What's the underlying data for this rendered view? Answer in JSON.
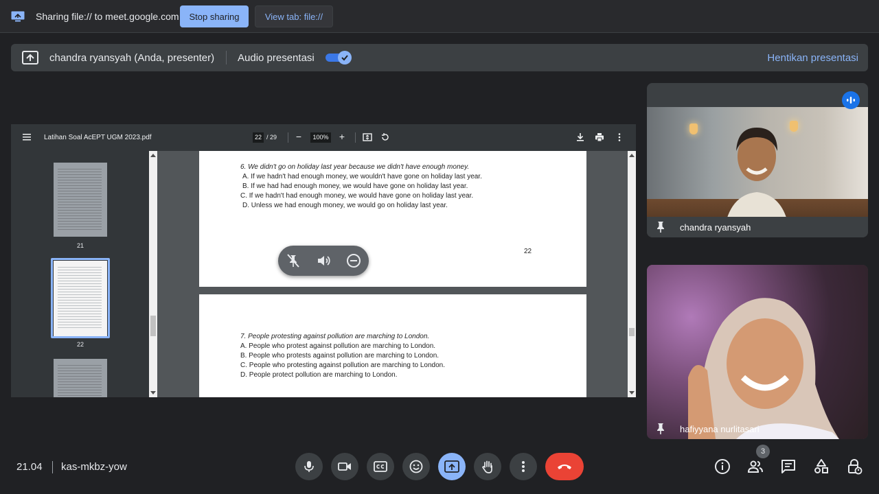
{
  "sharing_bar": {
    "text": "Sharing file:// to meet.google.com",
    "stop_label": "Stop sharing",
    "view_label": "View tab: file://"
  },
  "presenting_bar": {
    "presenter": "chandra ryansyah (Anda, presenter)",
    "audio_label": "Audio presentasi",
    "audio_on": true,
    "stop_label": "Hentikan presentasi"
  },
  "pdf": {
    "filename": "Latihan Soal AcEPT UGM 2023.pdf",
    "current_page": "22",
    "total_pages": "/ 29",
    "zoom": "100%",
    "thumbnails": [
      {
        "number": "21"
      },
      {
        "number": "22",
        "selected": true
      }
    ],
    "page_22": {
      "question": "6. We didn't go on holiday last year because we didn't have enough money.",
      "options": [
        "A. If we hadn't had enough money, we wouldn't have gone on holiday last year.",
        "B. If we had had enough money, we would have gone on holiday last year.",
        "C. If we hadn't had enough money, we would have gone on holiday last year.",
        "D. Unless we had enough money, we would go on holiday last year."
      ],
      "page_number": "22"
    },
    "page_23": {
      "question": "7. People protesting against pollution are marching to London.",
      "options": [
        "A. People who protest against pollution are marching to London.",
        "B. People who protests against pollution are marching to London.",
        "C. People who protesting against pollution are marching to London.",
        "D. People protect pollution are marching to London."
      ]
    }
  },
  "participants": [
    {
      "name": "chandra ryansyah",
      "speaking": true
    },
    {
      "name": "hafiyyana nurlitasari"
    }
  ],
  "bottom_bar": {
    "time": "21.04",
    "meeting_code": "kas-mkbz-yow",
    "people_count": "3"
  },
  "colors": {
    "accent": "#8ab4f8",
    "end_call": "#ea4335",
    "background": "#202124",
    "surface": "#3c4043"
  }
}
